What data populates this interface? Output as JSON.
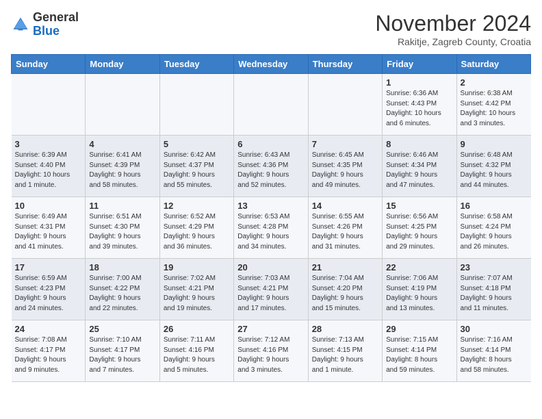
{
  "header": {
    "logo": {
      "general": "General",
      "blue": "Blue"
    },
    "title": "November 2024",
    "subtitle": "Rakitje, Zagreb County, Croatia"
  },
  "columns": [
    "Sunday",
    "Monday",
    "Tuesday",
    "Wednesday",
    "Thursday",
    "Friday",
    "Saturday"
  ],
  "weeks": [
    [
      {
        "day": "",
        "info": ""
      },
      {
        "day": "",
        "info": ""
      },
      {
        "day": "",
        "info": ""
      },
      {
        "day": "",
        "info": ""
      },
      {
        "day": "",
        "info": ""
      },
      {
        "day": "1",
        "info": "Sunrise: 6:36 AM\nSunset: 4:43 PM\nDaylight: 10 hours\nand 6 minutes."
      },
      {
        "day": "2",
        "info": "Sunrise: 6:38 AM\nSunset: 4:42 PM\nDaylight: 10 hours\nand 3 minutes."
      }
    ],
    [
      {
        "day": "3",
        "info": "Sunrise: 6:39 AM\nSunset: 4:40 PM\nDaylight: 10 hours\nand 1 minute."
      },
      {
        "day": "4",
        "info": "Sunrise: 6:41 AM\nSunset: 4:39 PM\nDaylight: 9 hours\nand 58 minutes."
      },
      {
        "day": "5",
        "info": "Sunrise: 6:42 AM\nSunset: 4:37 PM\nDaylight: 9 hours\nand 55 minutes."
      },
      {
        "day": "6",
        "info": "Sunrise: 6:43 AM\nSunset: 4:36 PM\nDaylight: 9 hours\nand 52 minutes."
      },
      {
        "day": "7",
        "info": "Sunrise: 6:45 AM\nSunset: 4:35 PM\nDaylight: 9 hours\nand 49 minutes."
      },
      {
        "day": "8",
        "info": "Sunrise: 6:46 AM\nSunset: 4:34 PM\nDaylight: 9 hours\nand 47 minutes."
      },
      {
        "day": "9",
        "info": "Sunrise: 6:48 AM\nSunset: 4:32 PM\nDaylight: 9 hours\nand 44 minutes."
      }
    ],
    [
      {
        "day": "10",
        "info": "Sunrise: 6:49 AM\nSunset: 4:31 PM\nDaylight: 9 hours\nand 41 minutes."
      },
      {
        "day": "11",
        "info": "Sunrise: 6:51 AM\nSunset: 4:30 PM\nDaylight: 9 hours\nand 39 minutes."
      },
      {
        "day": "12",
        "info": "Sunrise: 6:52 AM\nSunset: 4:29 PM\nDaylight: 9 hours\nand 36 minutes."
      },
      {
        "day": "13",
        "info": "Sunrise: 6:53 AM\nSunset: 4:28 PM\nDaylight: 9 hours\nand 34 minutes."
      },
      {
        "day": "14",
        "info": "Sunrise: 6:55 AM\nSunset: 4:26 PM\nDaylight: 9 hours\nand 31 minutes."
      },
      {
        "day": "15",
        "info": "Sunrise: 6:56 AM\nSunset: 4:25 PM\nDaylight: 9 hours\nand 29 minutes."
      },
      {
        "day": "16",
        "info": "Sunrise: 6:58 AM\nSunset: 4:24 PM\nDaylight: 9 hours\nand 26 minutes."
      }
    ],
    [
      {
        "day": "17",
        "info": "Sunrise: 6:59 AM\nSunset: 4:23 PM\nDaylight: 9 hours\nand 24 minutes."
      },
      {
        "day": "18",
        "info": "Sunrise: 7:00 AM\nSunset: 4:22 PM\nDaylight: 9 hours\nand 22 minutes."
      },
      {
        "day": "19",
        "info": "Sunrise: 7:02 AM\nSunset: 4:21 PM\nDaylight: 9 hours\nand 19 minutes."
      },
      {
        "day": "20",
        "info": "Sunrise: 7:03 AM\nSunset: 4:21 PM\nDaylight: 9 hours\nand 17 minutes."
      },
      {
        "day": "21",
        "info": "Sunrise: 7:04 AM\nSunset: 4:20 PM\nDaylight: 9 hours\nand 15 minutes."
      },
      {
        "day": "22",
        "info": "Sunrise: 7:06 AM\nSunset: 4:19 PM\nDaylight: 9 hours\nand 13 minutes."
      },
      {
        "day": "23",
        "info": "Sunrise: 7:07 AM\nSunset: 4:18 PM\nDaylight: 9 hours\nand 11 minutes."
      }
    ],
    [
      {
        "day": "24",
        "info": "Sunrise: 7:08 AM\nSunset: 4:17 PM\nDaylight: 9 hours\nand 9 minutes."
      },
      {
        "day": "25",
        "info": "Sunrise: 7:10 AM\nSunset: 4:17 PM\nDaylight: 9 hours\nand 7 minutes."
      },
      {
        "day": "26",
        "info": "Sunrise: 7:11 AM\nSunset: 4:16 PM\nDaylight: 9 hours\nand 5 minutes."
      },
      {
        "day": "27",
        "info": "Sunrise: 7:12 AM\nSunset: 4:16 PM\nDaylight: 9 hours\nand 3 minutes."
      },
      {
        "day": "28",
        "info": "Sunrise: 7:13 AM\nSunset: 4:15 PM\nDaylight: 9 hours\nand 1 minute."
      },
      {
        "day": "29",
        "info": "Sunrise: 7:15 AM\nSunset: 4:14 PM\nDaylight: 8 hours\nand 59 minutes."
      },
      {
        "day": "30",
        "info": "Sunrise: 7:16 AM\nSunset: 4:14 PM\nDaylight: 8 hours\nand 58 minutes."
      }
    ]
  ]
}
